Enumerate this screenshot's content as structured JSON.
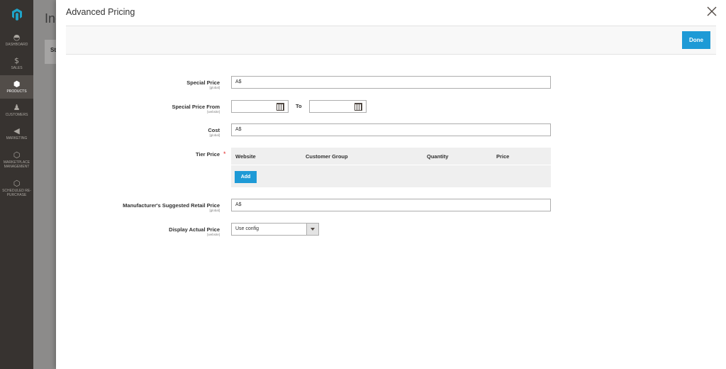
{
  "sidebar": {
    "items": [
      {
        "label": "DASHBOARD",
        "icon": "speedometer-icon",
        "glyph": "◓"
      },
      {
        "label": "SALES",
        "icon": "dollar-icon",
        "glyph": "$"
      },
      {
        "label": "PRODUCTS",
        "icon": "box-icon",
        "glyph": "⬢",
        "active": true
      },
      {
        "label": "CUSTOMERS",
        "icon": "person-icon",
        "glyph": "♟"
      },
      {
        "label": "MARKETING",
        "icon": "megaphone-icon",
        "glyph": "◀"
      },
      {
        "label": "MARKETPLACE MANAGEMENT",
        "icon": "hexagon-icon",
        "glyph": "⬡"
      },
      {
        "label": "SCHEDULED RE-PURCHASE",
        "icon": "hexagon-icon",
        "glyph": "⬡"
      }
    ]
  },
  "behind": {
    "title": "Inc",
    "box_text": "St"
  },
  "modal": {
    "title": "Advanced Pricing",
    "done_label": "Done"
  },
  "form": {
    "special_price": {
      "label": "Special Price",
      "scope": "[global]",
      "value": "A$"
    },
    "special_price_from": {
      "label": "Special Price From",
      "scope": "[website]",
      "from_value": "",
      "to_label": "To",
      "to_value": ""
    },
    "cost": {
      "label": "Cost",
      "scope": "[global]",
      "value": "A$"
    },
    "tier_price": {
      "label": "Tier Price",
      "required_mark": "*",
      "columns": [
        "Website",
        "Customer Group",
        "Quantity",
        "Price"
      ],
      "add_label": "Add"
    },
    "msrp": {
      "label": "Manufacturer's Suggested Retail Price",
      "scope": "[global]",
      "value": "A$"
    },
    "display_actual_price": {
      "label": "Display Actual Price",
      "scope": "[website]",
      "value": "Use config"
    }
  },
  "colors": {
    "primary": "#1e9ad6",
    "sidebar": "#373330",
    "required": "#e22626",
    "logo": "#1fa3c8"
  }
}
